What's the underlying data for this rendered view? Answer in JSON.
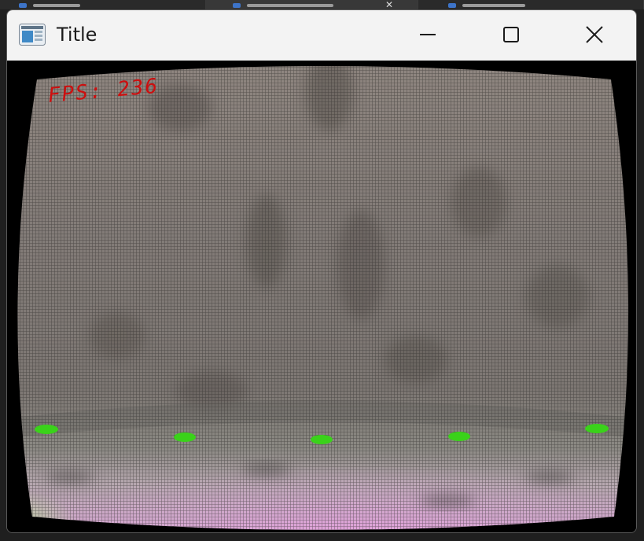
{
  "window": {
    "title": "Title",
    "controls": [
      "minimize",
      "maximize",
      "close"
    ]
  },
  "overlay": {
    "fps_label": "FPS:",
    "fps_value": "236",
    "color": "#cc0f0f"
  },
  "markers": {
    "count": 5,
    "color": "#3ad21a"
  },
  "icons": {
    "app": "app-window-icon",
    "minimize": "minimize-icon",
    "maximize": "maximize-icon",
    "close": "close-icon"
  }
}
